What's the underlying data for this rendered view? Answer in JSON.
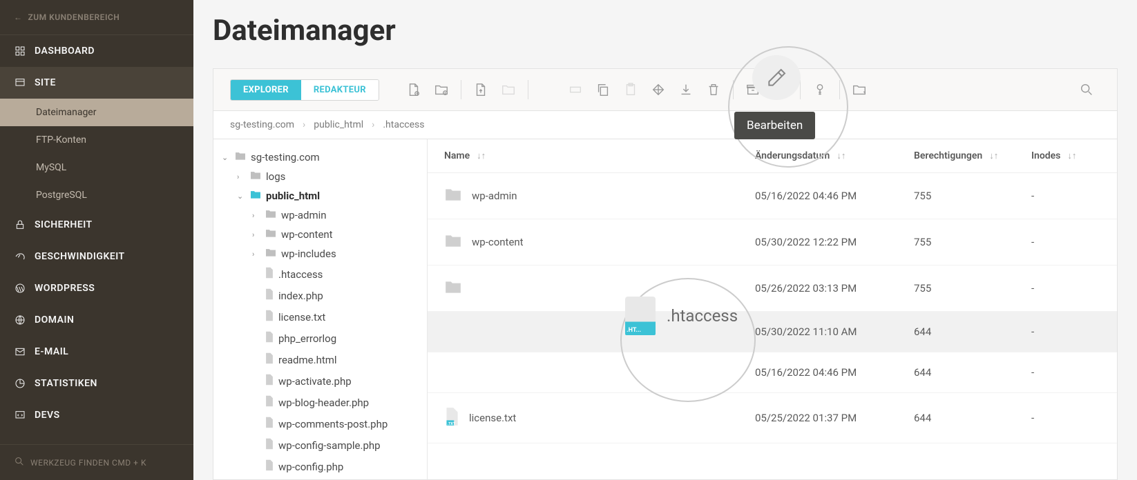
{
  "sidebar": {
    "back_label": "ZUM KUNDENBEREICH",
    "items": [
      {
        "label": "DASHBOARD"
      },
      {
        "label": "SITE"
      },
      {
        "label": "SICHERHEIT"
      },
      {
        "label": "GESCHWINDIGKEIT"
      },
      {
        "label": "WORDPRESS"
      },
      {
        "label": "DOMAIN"
      },
      {
        "label": "E-MAIL"
      },
      {
        "label": "STATISTIKEN"
      },
      {
        "label": "DEVS"
      }
    ],
    "site_sub": [
      {
        "label": "Dateimanager",
        "active": true
      },
      {
        "label": "FTP-Konten"
      },
      {
        "label": "MySQL"
      },
      {
        "label": "PostgreSQL"
      }
    ],
    "search_label": "WERKZEUG FINDEN CMD + K"
  },
  "page": {
    "title": "Dateimanager"
  },
  "toolbar": {
    "tabs": [
      {
        "label": "EXPLORER",
        "active": true
      },
      {
        "label": "REDAKTEUR",
        "active": false
      }
    ],
    "tooltip": "Bearbeiten"
  },
  "breadcrumb": [
    "sg-testing.com",
    "public_html",
    ".htaccess"
  ],
  "tree": [
    {
      "depth": 0,
      "type": "folder",
      "label": "sg-testing.com",
      "open": true
    },
    {
      "depth": 1,
      "type": "folder",
      "label": "logs",
      "open": false,
      "has_children": true
    },
    {
      "depth": 1,
      "type": "folder",
      "label": "public_html",
      "open": true,
      "selected": true
    },
    {
      "depth": 2,
      "type": "folder",
      "label": "wp-admin",
      "open": false,
      "has_children": true
    },
    {
      "depth": 2,
      "type": "folder",
      "label": "wp-content",
      "open": false,
      "has_children": true
    },
    {
      "depth": 2,
      "type": "folder",
      "label": "wp-includes",
      "open": false,
      "has_children": true
    },
    {
      "depth": 2,
      "type": "file",
      "label": ".htaccess"
    },
    {
      "depth": 2,
      "type": "file",
      "label": "index.php"
    },
    {
      "depth": 2,
      "type": "file",
      "label": "license.txt"
    },
    {
      "depth": 2,
      "type": "file",
      "label": "php_errorlog"
    },
    {
      "depth": 2,
      "type": "file",
      "label": "readme.html"
    },
    {
      "depth": 2,
      "type": "file",
      "label": "wp-activate.php"
    },
    {
      "depth": 2,
      "type": "file",
      "label": "wp-blog-header.php"
    },
    {
      "depth": 2,
      "type": "file",
      "label": "wp-comments-post.php"
    },
    {
      "depth": 2,
      "type": "file",
      "label": "wp-config-sample.php"
    },
    {
      "depth": 2,
      "type": "file",
      "label": "wp-config.php"
    }
  ],
  "list": {
    "headers": {
      "name": "Name",
      "date": "Änderungsdatum",
      "perm": "Berechtigungen",
      "inodes": "Inodes"
    },
    "rows": [
      {
        "type": "folder",
        "name": "wp-admin",
        "date": "05/16/2022 04:46 PM",
        "perm": "755",
        "inodes": "-"
      },
      {
        "type": "folder",
        "name": "wp-content",
        "date": "05/30/2022 12:22 PM",
        "perm": "755",
        "inodes": "-"
      },
      {
        "type": "folder",
        "name": "",
        "date": "05/26/2022 03:13 PM",
        "perm": "755",
        "inodes": "-"
      },
      {
        "type": "file",
        "name": ".htaccess",
        "date": "05/30/2022 11:10 AM",
        "perm": "644",
        "inodes": "-",
        "selected": true,
        "hidden_name": true
      },
      {
        "type": "file",
        "name": "",
        "date": "05/16/2022 04:46 PM",
        "perm": "644",
        "inodes": "-",
        "hidden_name": true
      },
      {
        "type": "txt",
        "name": "license.txt",
        "date": "05/25/2022 01:37 PM",
        "perm": "644",
        "inodes": "-"
      }
    ]
  },
  "highlight": {
    "htaccess_label": ".htaccess"
  }
}
